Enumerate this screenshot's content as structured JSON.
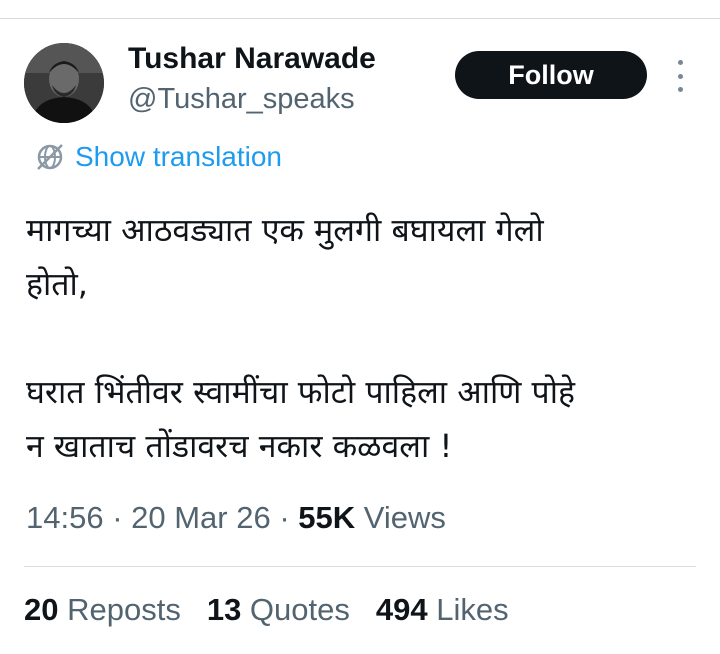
{
  "colors": {
    "text": "#0f1419",
    "secondary": "#536471",
    "link": "#1d9bf0",
    "button_bg": "#0f1419",
    "button_text": "#ffffff",
    "divider": "#d8dde1"
  },
  "author": {
    "name": "Tushar Narawade",
    "handle": "@Tushar_speaks"
  },
  "follow_button": {
    "label": "Follow"
  },
  "more_icon": "more-vertical-icon",
  "translation": {
    "icon": "globe-slash-icon",
    "label": "Show translation"
  },
  "tweet": {
    "lines": [
      "मागच्या आठवड्यात एक मुलगी बघायला गेलो",
      "होतो,",
      "",
      "घरात भिंतीवर स्वामींचा फोटो पाहिला आणि पोहे",
      "न खाताच तोंडावरच नकार कळवला !"
    ]
  },
  "meta": {
    "time": "14:56",
    "sep1": " · ",
    "date": "20 Mar 26",
    "sep2": " · ",
    "views_count": "55K",
    "views_label": " Views"
  },
  "stats": [
    {
      "count": "20",
      "label": " Reposts"
    },
    {
      "count": "13",
      "label": " Quotes"
    },
    {
      "count": "494",
      "label": " Likes"
    }
  ]
}
